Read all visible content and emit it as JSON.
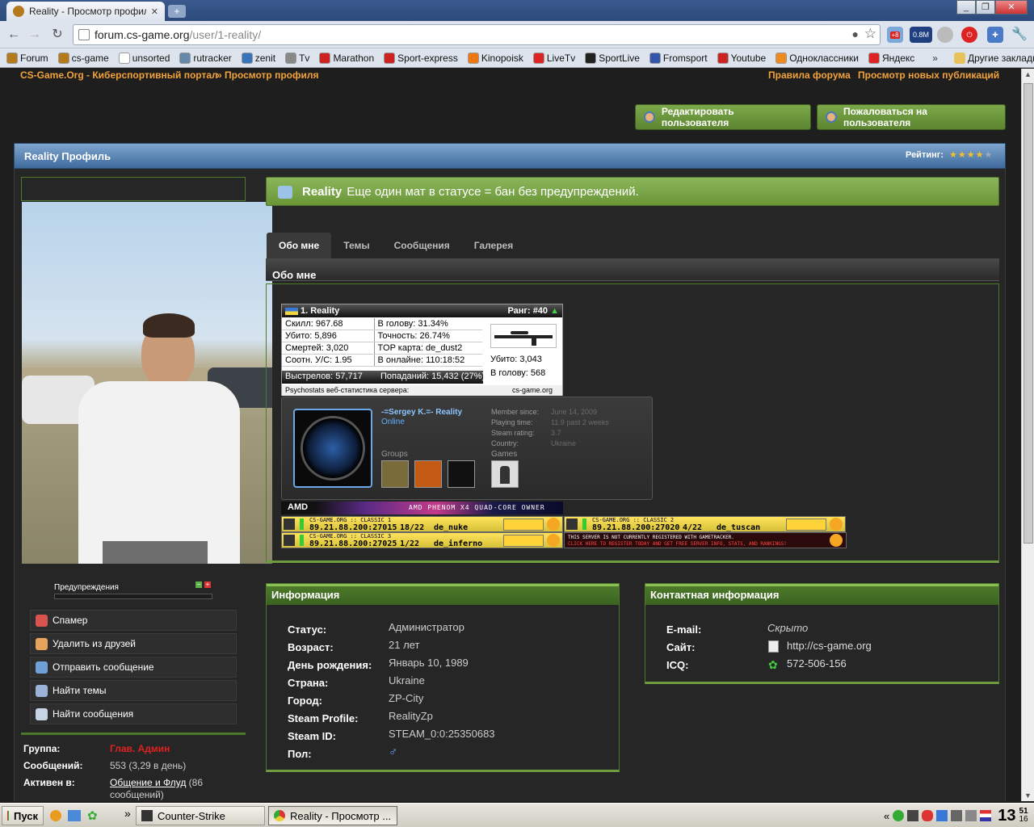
{
  "browser": {
    "tab_title": "Reality - Просмотр профиля",
    "url_host": "forum.cs-game.org",
    "url_path": "/user/1-reality/",
    "ext_badge_1": "+8",
    "ext_badge_2": "0.8M"
  },
  "bookmarks": [
    {
      "label": "Forum",
      "color": "#b47a1c"
    },
    {
      "label": "cs-game",
      "color": "#b47a1c"
    },
    {
      "label": "unsorted",
      "color": "#ffffff"
    },
    {
      "label": "rutracker",
      "color": "#6688aa"
    },
    {
      "label": "zenit",
      "color": "#3a74b8"
    },
    {
      "label": "Tv",
      "color": "#888888"
    },
    {
      "label": "Marathon",
      "color": "#cc2222"
    },
    {
      "label": "Sport-express",
      "color": "#cc2222"
    },
    {
      "label": "Kinopoisk",
      "color": "#ee7711"
    },
    {
      "label": "LiveTv",
      "color": "#dd2222"
    },
    {
      "label": "SportLive",
      "color": "#222222"
    },
    {
      "label": "Fromsport",
      "color": "#3355aa"
    },
    {
      "label": "Youtube",
      "color": "#cc2222"
    },
    {
      "label": "Одноклассники",
      "color": "#f08a1e"
    },
    {
      "label": "Яндекс",
      "color": "#dd2222"
    }
  ],
  "other_bookmarks": "Другие закладки",
  "breadcrumb": {
    "site": "CS-Game.Org - Киберспортивный портал",
    "current": "» Просмотр профиля"
  },
  "top_links": {
    "rules": "Правила форума",
    "new_posts": "Просмотр новых публикаций"
  },
  "actions": {
    "edit": "Редактировать пользователя",
    "report": "Пожаловаться на пользователя"
  },
  "profile": {
    "header": "Reality Профиль",
    "rating_label": "Рейтинг:",
    "rating": 4,
    "rating_max": 5,
    "username": "Reality",
    "status_text": "Еще один мат в статусе = бан без предупреждений."
  },
  "warnings": {
    "label": "Предупреждения",
    "minus": "−",
    "plus": "+",
    "level": 0
  },
  "side_actions": [
    {
      "label": "Спамер",
      "color": "#d9534f"
    },
    {
      "label": "Удалить из друзей",
      "color": "#e6a45c"
    },
    {
      "label": "Отправить сообщение",
      "color": "#6fa0d8"
    },
    {
      "label": "Найти темы",
      "color": "#9bb3d6"
    },
    {
      "label": "Найти сообщения",
      "color": "#c7d4e6"
    }
  ],
  "member_info": {
    "group_label": "Группа:",
    "group": "Глав. Админ",
    "posts_label": "Сообщений:",
    "posts": "553 (3,29 в день)",
    "active_label": "Активен в:",
    "active_forum": "Общение и Флуд",
    "active_count": "(86",
    "active_suffix": "сообщений)"
  },
  "tabs": [
    {
      "label": "Обо мне",
      "active": true
    },
    {
      "label": "Темы",
      "active": false
    },
    {
      "label": "Сообщения",
      "active": false
    },
    {
      "label": "Галерея",
      "active": false
    }
  ],
  "about_title": "Обо мне",
  "stats_widget": {
    "player": "1. Reality",
    "rank": "Ранг: #40",
    "rows": [
      [
        "Скилл: 967.68",
        "В голову: 31.34%"
      ],
      [
        "Убито: 5,896",
        "Точность: 26.74%"
      ],
      [
        "Смертей: 3,020",
        "TOP карта: de_dust2"
      ],
      [
        "Соотн. У/С: 1.95",
        "В онлайне: 110:18:52"
      ]
    ],
    "weapon_kills": "Убито: 3,043",
    "weapon_hs": "В голову: 568",
    "shots": "Выстрелов: 57,717",
    "hits": "Попаданий: 15,432 (27%)",
    "footer_left": "Psychostats веб-статистика сервера:",
    "footer_right": "cs-game.org"
  },
  "steam_card": {
    "name": "-=Sergey K.=- Reality",
    "state": "Online",
    "fields": [
      [
        "Member since:",
        "June 14, 2009"
      ],
      [
        "Playing time:",
        "11.9 past 2 weeks"
      ],
      [
        "Steam rating:",
        "3.7"
      ],
      [
        "Country:",
        "Ukraine"
      ]
    ],
    "groups_label": "Groups",
    "games_label": "Games"
  },
  "amd_banner": {
    "brand": "AMD",
    "text": "AMD PHENOM X4 QUAD-CORE OWNER"
  },
  "servers": [
    {
      "name": "CS-GAME.ORG :: CLASSIC 1",
      "ip": "89.21.88.200:27015",
      "players": "18/22",
      "map": "de_nuke"
    },
    {
      "name": "CS-GAME.ORG :: CLASSIC 2",
      "ip": "89.21.88.200:27020",
      "players": "4/22",
      "map": "de_tuscan"
    },
    {
      "name": "CS-GAME.ORG :: CLASSIC 3",
      "ip": "89.21.88.200:27025",
      "players": "1/22",
      "map": "de_inferno"
    }
  ],
  "unregistered": {
    "line1": "THIS SERVER IS NOT CURRENTLY REGISTERED WITH GAMETRACKER.",
    "line2": "CLICK HERE TO REGISTER TODAY AND GET FREE SERVER INFO, STATS, AND RANKINGS!"
  },
  "info": {
    "title": "Информация",
    "rows": [
      [
        "Статус:",
        "Администратор"
      ],
      [
        "Возраст:",
        "21 лет"
      ],
      [
        "День рождения:",
        "Январь 10, 1989"
      ],
      [
        "Страна:",
        "Ukraine"
      ],
      [
        "Город:",
        "ZP-City"
      ],
      [
        "Steam Profile:",
        "RealityZp"
      ],
      [
        "Steam ID:",
        "STEAM_0:0:25350683"
      ],
      [
        "Пол:",
        ""
      ]
    ]
  },
  "contact": {
    "title": "Контактная информация",
    "email_label": "E-mail:",
    "email": "Скрыто",
    "site_label": "Сайт:",
    "site": "http://cs-game.org",
    "icq_label": "ICQ:",
    "icq": "572-506-156"
  },
  "taskbar": {
    "start": "Пуск",
    "item1": "Counter-Strike",
    "item2": "Reality - Просмотр ...",
    "chevron": "»",
    "tray_chevron": "«",
    "time": "13",
    "minutes": "51",
    "day": "16"
  }
}
